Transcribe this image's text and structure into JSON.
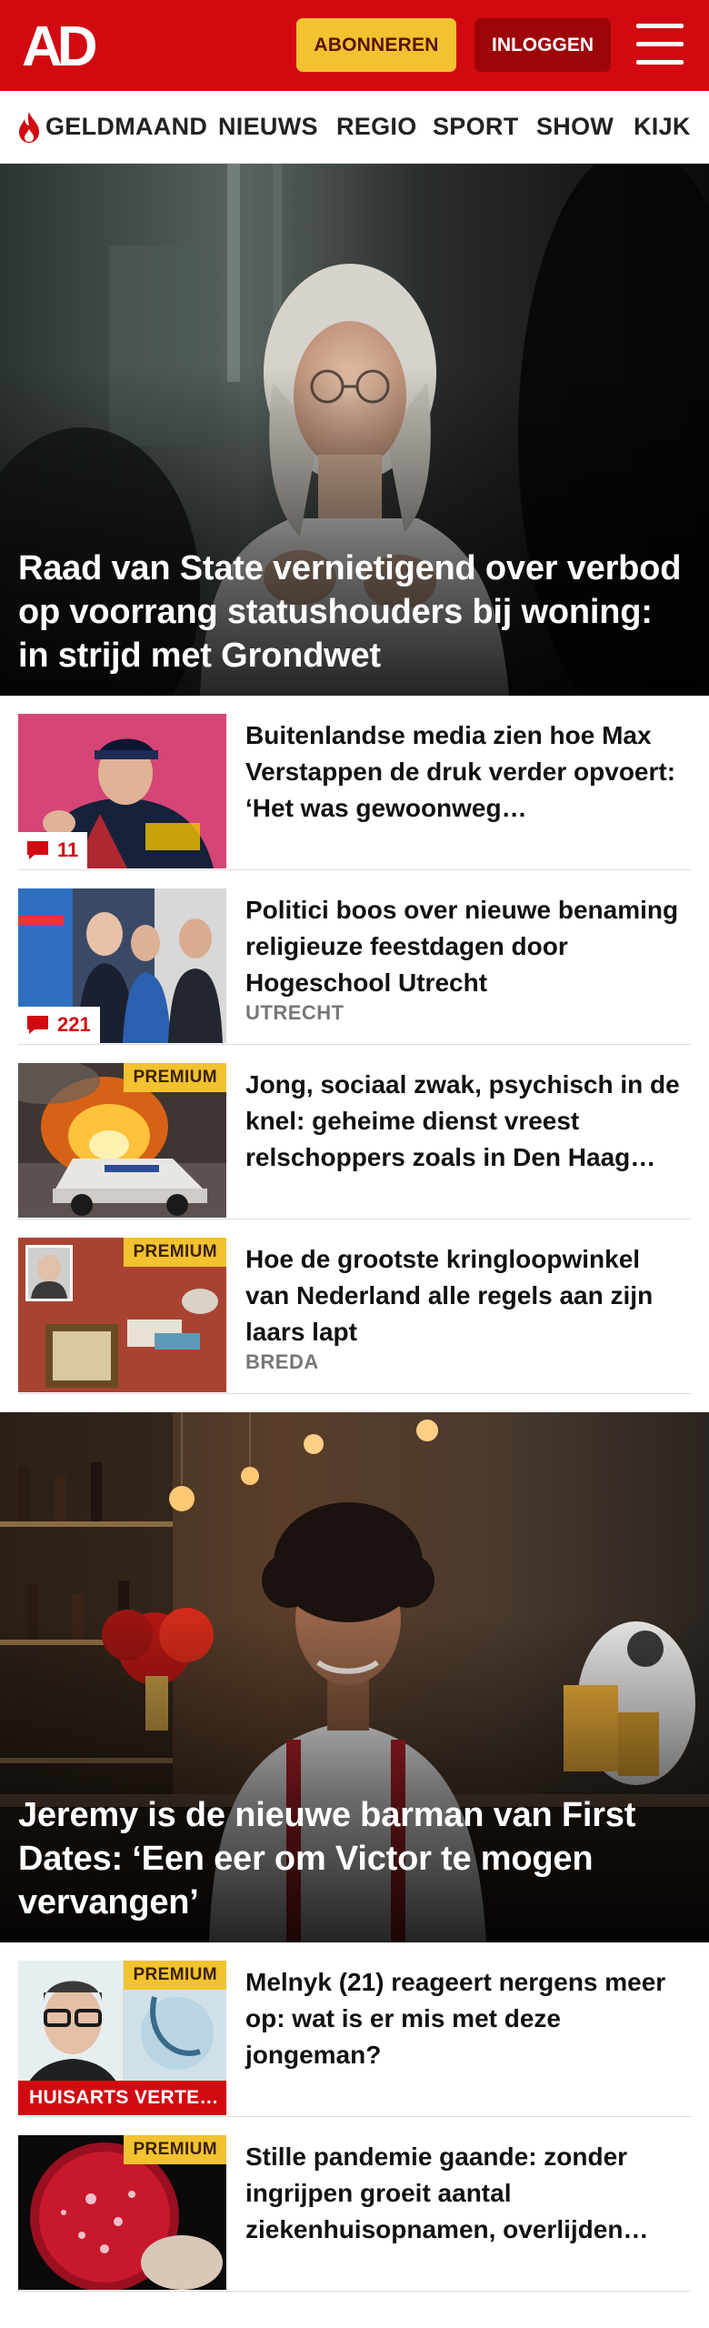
{
  "header": {
    "logo_text": "AD",
    "subscribe_label": "ABONNEREN",
    "login_label": "INLOGGEN"
  },
  "nav": {
    "items": [
      "GELDMAAND",
      "NIEUWS",
      "REGIO",
      "SPORT",
      "SHOW",
      "KIJK"
    ]
  },
  "hero1": {
    "title": "Raad van State vernietigend over verbod op voorrang statushouders bij woning: in strijd met Grondwet"
  },
  "articles": [
    {
      "title": "Buitenlandse media zien hoe Max Verstappen de druk verder opvoert: ‘Het was gewoonweg…",
      "comments": "11"
    },
    {
      "title": "Politici boos over nieuwe benaming religieuze feestdagen door Hogeschool Utrecht",
      "kicker": "UTRECHT",
      "comments": "221"
    },
    {
      "title": "Jong, sociaal zwak, psychisch in de knel: geheime dienst vreest relschoppers zoals in Den Haag…",
      "premium": "PREMIUM"
    },
    {
      "title": "Hoe de grootste kringloopwinkel van Nederland alle regels aan zijn laars lapt",
      "kicker": "BREDA",
      "premium": "PREMIUM"
    }
  ],
  "hero2": {
    "title": "Jeremy is de nieuwe barman van First Dates: ‘Een eer om Victor te mogen vervangen’"
  },
  "articles2": [
    {
      "title": "Melnyk (21) reageert nergens meer op: wat is er mis met deze jongeman?",
      "premium": "PREMIUM",
      "label": "HUISARTS VERTE…"
    },
    {
      "title": "Stille pandemie gaande: zonder ingrijpen groeit aantal ziekenhuisopnamen, overlijden…",
      "premium": "PREMIUM"
    }
  ],
  "colors": {
    "brand_red": "#d10a11",
    "subscribe_yellow": "#f2c230",
    "login_dark_red": "#9e0509",
    "premium_yellow": "#f2c230"
  }
}
